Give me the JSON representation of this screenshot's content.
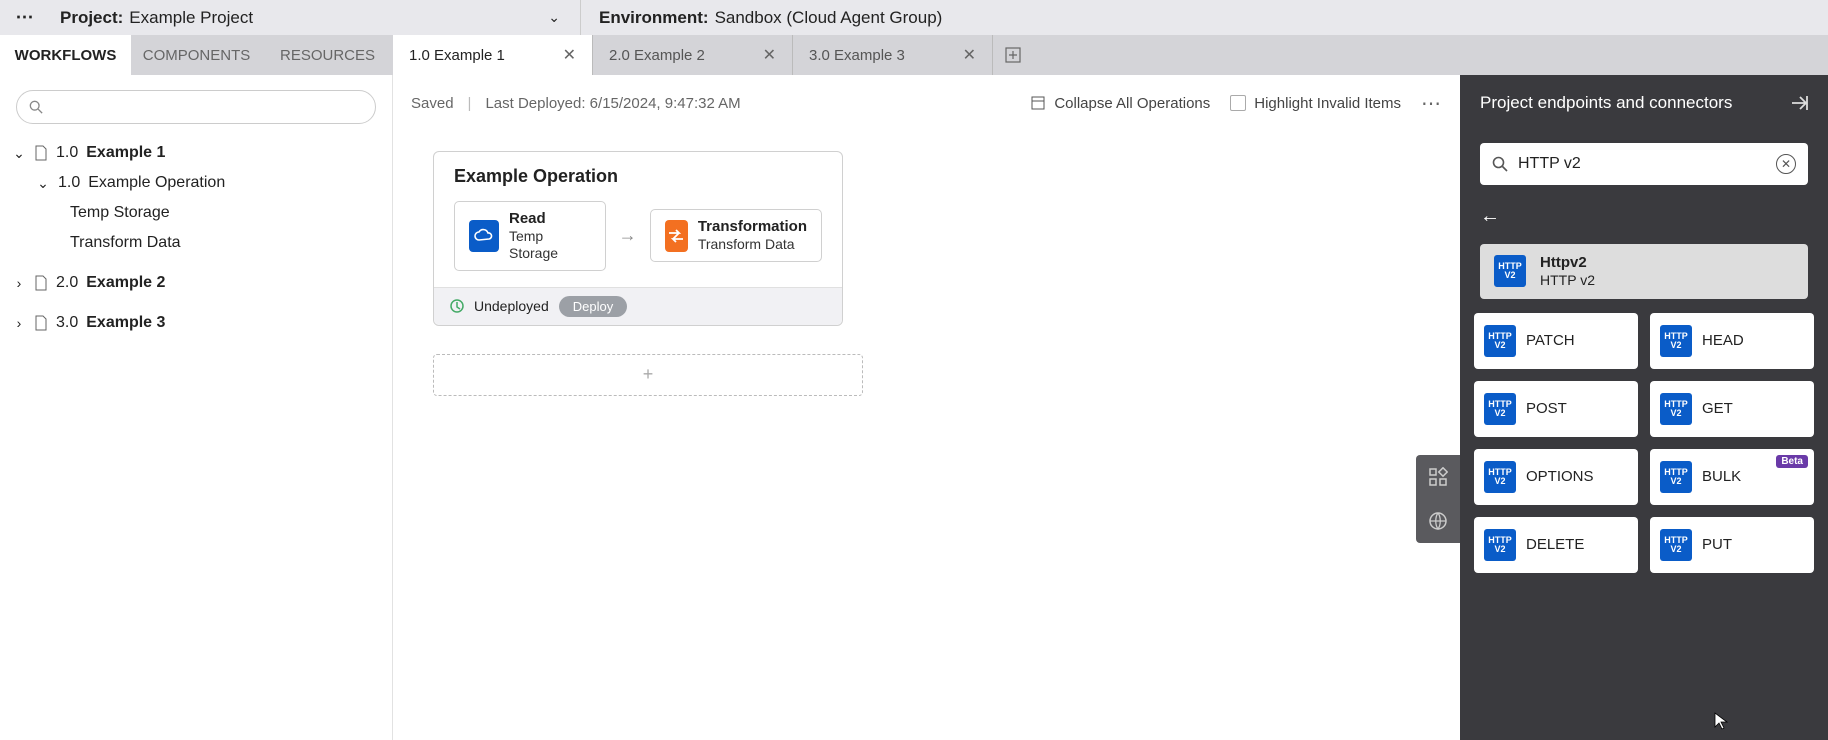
{
  "top": {
    "project_label": "Project:",
    "project_name": "Example Project",
    "env_label": "Environment:",
    "env_name": "Sandbox (Cloud Agent Group)"
  },
  "ltabs": {
    "workflows": "WORKFLOWS",
    "components": "COMPONENTS",
    "resources": "RESOURCES"
  },
  "dtabs": [
    {
      "label": "1.0  Example 1",
      "active": true
    },
    {
      "label": "2.0  Example 2",
      "active": false
    },
    {
      "label": "3.0  Example 3",
      "active": false
    }
  ],
  "tree": {
    "n1": {
      "num": "1.0",
      "label": "Example 1"
    },
    "n1c": {
      "num": "1.0",
      "label": "Example Operation"
    },
    "leaf1": "Temp Storage",
    "leaf2": "Transform Data",
    "n2": {
      "num": "2.0",
      "label": "Example 2"
    },
    "n3": {
      "num": "3.0",
      "label": "Example 3"
    }
  },
  "canvas": {
    "saved": "Saved",
    "deployed": "Last Deployed: 6/15/2024, 9:47:32 AM",
    "collapse": "Collapse All Operations",
    "highlight": "Highlight Invalid Items",
    "op_title": "Example Operation",
    "act1": {
      "t1": "Read",
      "t2": "Temp Storage"
    },
    "act2": {
      "t1": "Transformation",
      "t2": "Transform Data"
    },
    "status": "Undeployed",
    "deploy": "Deploy",
    "plus": "+"
  },
  "panel": {
    "title": "Project endpoints and connectors",
    "search": "HTTP v2",
    "badge1": "HTTP",
    "badge2": "V2",
    "result": {
      "t1": "Httpv2",
      "t2": "HTTP v2"
    },
    "cards": [
      {
        "label": "PATCH",
        "beta": false
      },
      {
        "label": "HEAD",
        "beta": false
      },
      {
        "label": "POST",
        "beta": false
      },
      {
        "label": "GET",
        "beta": false
      },
      {
        "label": "OPTIONS",
        "beta": false
      },
      {
        "label": "BULK",
        "beta": true
      },
      {
        "label": "DELETE",
        "beta": false
      },
      {
        "label": "PUT",
        "beta": false
      }
    ],
    "beta_label": "Beta"
  }
}
